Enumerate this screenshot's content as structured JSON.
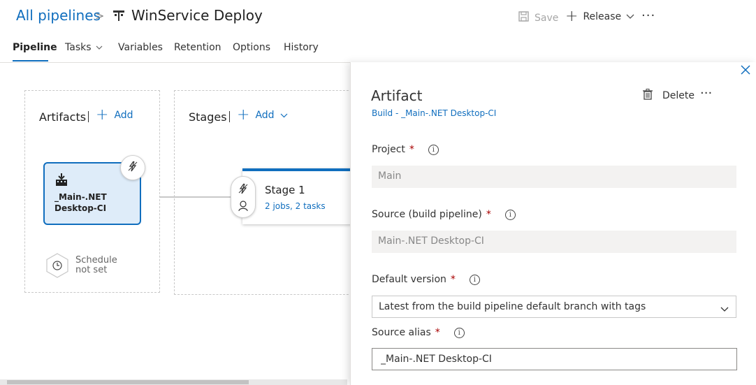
{
  "header": {
    "breadcrumb_root": "All pipelines",
    "breadcrumb_sep": ">",
    "title": "WinService Deploy",
    "save_label": "Save",
    "release_label": "Release",
    "more_label": "···"
  },
  "tabs": [
    {
      "label": "Pipeline",
      "active": true
    },
    {
      "label": "Tasks"
    },
    {
      "label": "Variables"
    },
    {
      "label": "Retention"
    },
    {
      "label": "Options"
    },
    {
      "label": "History"
    }
  ],
  "artifacts": {
    "section_label": "Artifacts",
    "add_label": "Add",
    "card_name": "_Main-.NET Desktop-CI",
    "schedule_line1": "Schedule",
    "schedule_line2": "not set"
  },
  "stages": {
    "section_label": "Stages",
    "add_label": "Add",
    "stage_name": "Stage 1",
    "stage_detail": "2 jobs, 2 tasks"
  },
  "panel": {
    "title": "Artifact",
    "subtitle": "Build - _Main-.NET Desktop-CI",
    "delete_label": "Delete",
    "more_label": "···",
    "project": {
      "label": "Project",
      "required": "*",
      "value": "Main"
    },
    "source": {
      "label": "Source (build pipeline)",
      "required": "*",
      "value": "Main-.NET Desktop-CI"
    },
    "default_version": {
      "label": "Default version",
      "required": "*",
      "value": "Latest from the build pipeline default branch with tags"
    },
    "source_alias": {
      "label": "Source alias",
      "required": "*",
      "value": "_Main-.NET Desktop-CI"
    }
  },
  "colors": {
    "accent": "#106ebe",
    "card_bg": "#deecf9",
    "required": "#a80000"
  }
}
